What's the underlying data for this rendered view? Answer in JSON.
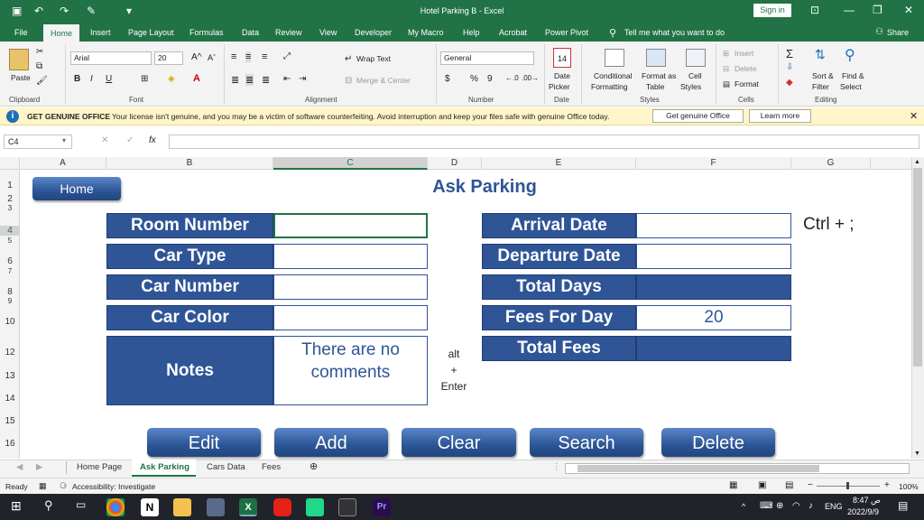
{
  "window": {
    "title": "Hotel Parking B  -  Excel",
    "sign_in": "Sign in"
  },
  "menu": {
    "tabs": [
      "File",
      "Home",
      "Insert",
      "Page Layout",
      "Formulas",
      "Data",
      "Review",
      "View",
      "Developer",
      "My Macro",
      "Help",
      "Acrobat",
      "Power Pivot"
    ],
    "tell_me": "Tell me what you want to do",
    "share": "Share"
  },
  "ribbon": {
    "paste": "Paste",
    "font_name": "Arial",
    "font_size": "20",
    "wrap_text": "Wrap Text",
    "merge_center": "Merge & Center",
    "number_format": "General",
    "date_picker_num": "14",
    "date_picker": "Date",
    "date_picker2": "Picker",
    "conditional": "Conditional",
    "formatting": "Formatting",
    "format_as": "Format as",
    "table": "Table",
    "cell": "Cell",
    "styles": "Styles",
    "insert": "Insert",
    "delete": "Delete",
    "format": "Format",
    "sort_filter": "Sort &",
    "filter": "Filter",
    "find_select": "Find &",
    "select": "Select",
    "groups": {
      "clipboard": "Clipboard",
      "font": "Font",
      "alignment": "Alignment",
      "number": "Number",
      "date": "Date",
      "styles": "Styles",
      "cells": "Cells",
      "editing": "Editing"
    }
  },
  "infobar": {
    "heading": "GET GENUINE OFFICE",
    "message": "Your license isn't genuine, and you may be a victim of software counterfeiting. Avoid interruption and keep your files safe with genuine Office today.",
    "get_button": "Get genuine Office",
    "learn_button": "Learn more"
  },
  "formula_bar": {
    "name_box": "C4",
    "fx": "fx",
    "value": ""
  },
  "columns": [
    "A",
    "B",
    "C",
    "D",
    "E",
    "F",
    "G"
  ],
  "rows": [
    "1",
    "2",
    "3",
    "4",
    "5",
    "6",
    "7",
    "8",
    "9",
    "10",
    "12",
    "13",
    "14",
    "15",
    "16"
  ],
  "form": {
    "home_button": "Home",
    "title": "Ask Parking",
    "room_number": "Room Number",
    "car_type": "Car Type",
    "car_number": "Car Number",
    "car_color": "Car Color",
    "notes": "Notes",
    "notes_value": "There are no comments",
    "arrival_date": "Arrival Date",
    "departure_date": "Departure Date",
    "total_days": "Total Days",
    "fees_for_day": "Fees For Day",
    "fees_value": "20",
    "total_fees": "Total Fees",
    "shortcut_date": "Ctrl + ;",
    "alt": "alt",
    "plus": "+",
    "enter": "Enter"
  },
  "actions": {
    "edit": "Edit",
    "add": "Add",
    "clear": "Clear",
    "search": "Search",
    "delete": "Delete"
  },
  "sheets": [
    "Home Page",
    "Ask Parking",
    "Cars Data",
    "Fees"
  ],
  "status": {
    "ready": "Ready",
    "accessibility": "Accessibility: Investigate",
    "zoom": "100%"
  },
  "taskbar": {
    "lang": "ENG",
    "time": "8:47 ص",
    "date": "2022/9/9"
  }
}
